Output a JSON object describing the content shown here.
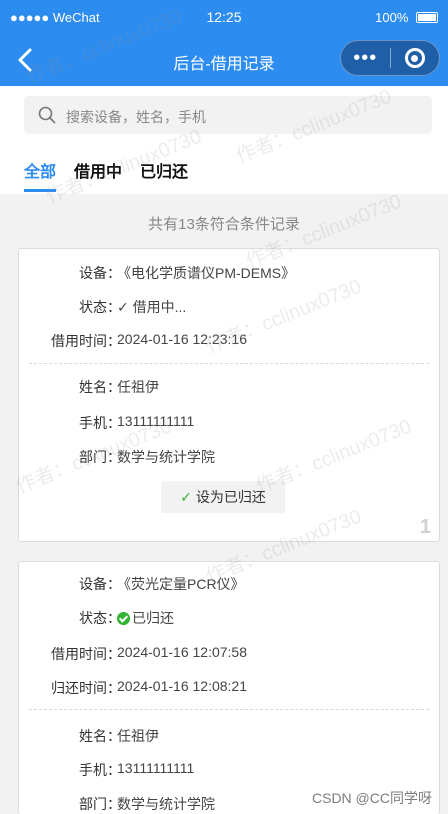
{
  "status_bar": {
    "carrier": "●●●●● WeChat",
    "time": "12:25",
    "battery": "100%"
  },
  "nav": {
    "title": "后台-借用记录",
    "more_glyph": "•••"
  },
  "search": {
    "placeholder": "搜索设备，姓名，手机"
  },
  "tabs": [
    {
      "label": "全部",
      "active": true
    },
    {
      "label": "借用中",
      "active": false
    },
    {
      "label": "已归还",
      "active": false
    }
  ],
  "summary": "共有13条符合条件记录",
  "records": [
    {
      "device_label": "设备：",
      "device": "《电化学质谱仪PM-DEMS》",
      "status_label": "状态：",
      "status": "借用中...",
      "borrow_time_label": "借用时间：",
      "borrow_time": "2024-01-16 12:23:16",
      "name_label": "姓名：",
      "name": "任祖伊",
      "phone_label": "手机：",
      "phone": "13111111111",
      "dept_label": "部门：",
      "dept": "数学与统计学院",
      "action_label": "设为已归还",
      "index": "1"
    },
    {
      "device_label": "设备：",
      "device": "《荧光定量PCR仪》",
      "status_label": "状态：",
      "status": "已归还",
      "borrow_time_label": "借用时间：",
      "borrow_time": "2024-01-16 12:07:58",
      "return_time_label": "归还时间：",
      "return_time": "2024-01-16 12:08:21",
      "name_label": "姓名：",
      "name": "任祖伊",
      "phone_label": "手机：",
      "phone": "13111111111",
      "dept_label": "部门：",
      "dept": "数学与统计学院"
    }
  ],
  "watermark": "作者：cclinux0730",
  "credit": "CSDN @CC同学呀",
  "colors": {
    "primary": "#2d8cf0",
    "success": "#34b233"
  }
}
